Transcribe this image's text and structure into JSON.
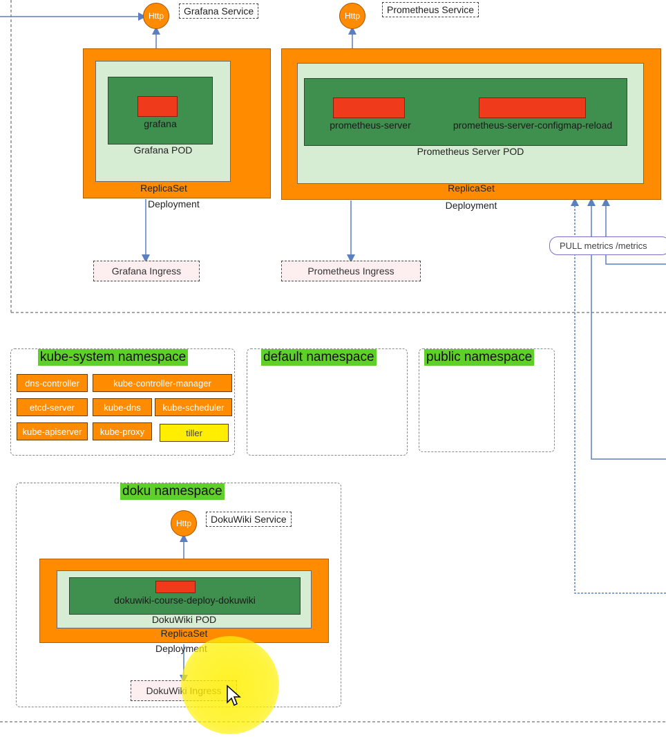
{
  "monitoring": {
    "grafana": {
      "http": "Http",
      "service": "Grafana Service",
      "container": "grafana",
      "pod": "Grafana POD",
      "replicaset": "ReplicaSet",
      "deployment": "Deployment",
      "ingress": "Grafana Ingress"
    },
    "prometheus": {
      "http": "Http",
      "service": "Prometheus Service",
      "container_1": "prometheus-server",
      "container_2": "prometheus-server-configmap-reload",
      "pod": "Prometheus Server POD",
      "replicaset": "ReplicaSet",
      "deployment": "Deployment",
      "ingress": "Prometheus Ingress"
    },
    "pull_metrics": "PULL metrics /metrics"
  },
  "namespaces": {
    "kube_system": {
      "title": "kube-system namespace",
      "items": [
        "dns-controller",
        "kube-controller-manager",
        "etcd-server",
        "kube-dns",
        "kube-scheduler",
        "kube-apiserver",
        "kube-proxy",
        "tiller"
      ]
    },
    "default": {
      "title": "default namespace"
    },
    "public": {
      "title": "public namespace"
    },
    "doku": {
      "title": "doku namespace",
      "http": "Http",
      "service": "DokuWiki Service",
      "container": "dokuwiki-course-deploy-dokuwiki",
      "pod": "DokuWiki POD",
      "replicaset": "ReplicaSet",
      "deployment": "Deployment",
      "ingress": "DokuWiki Ingress"
    }
  },
  "colors": {
    "orange": "#ff8c00",
    "pod_bg": "#d6ecd3",
    "container_bg": "#3f8f4f",
    "container_chip": "#ef3b1c",
    "namespace_title": "#5fd02a",
    "tiller": "#ffee00",
    "line": "#5b7fbf"
  }
}
